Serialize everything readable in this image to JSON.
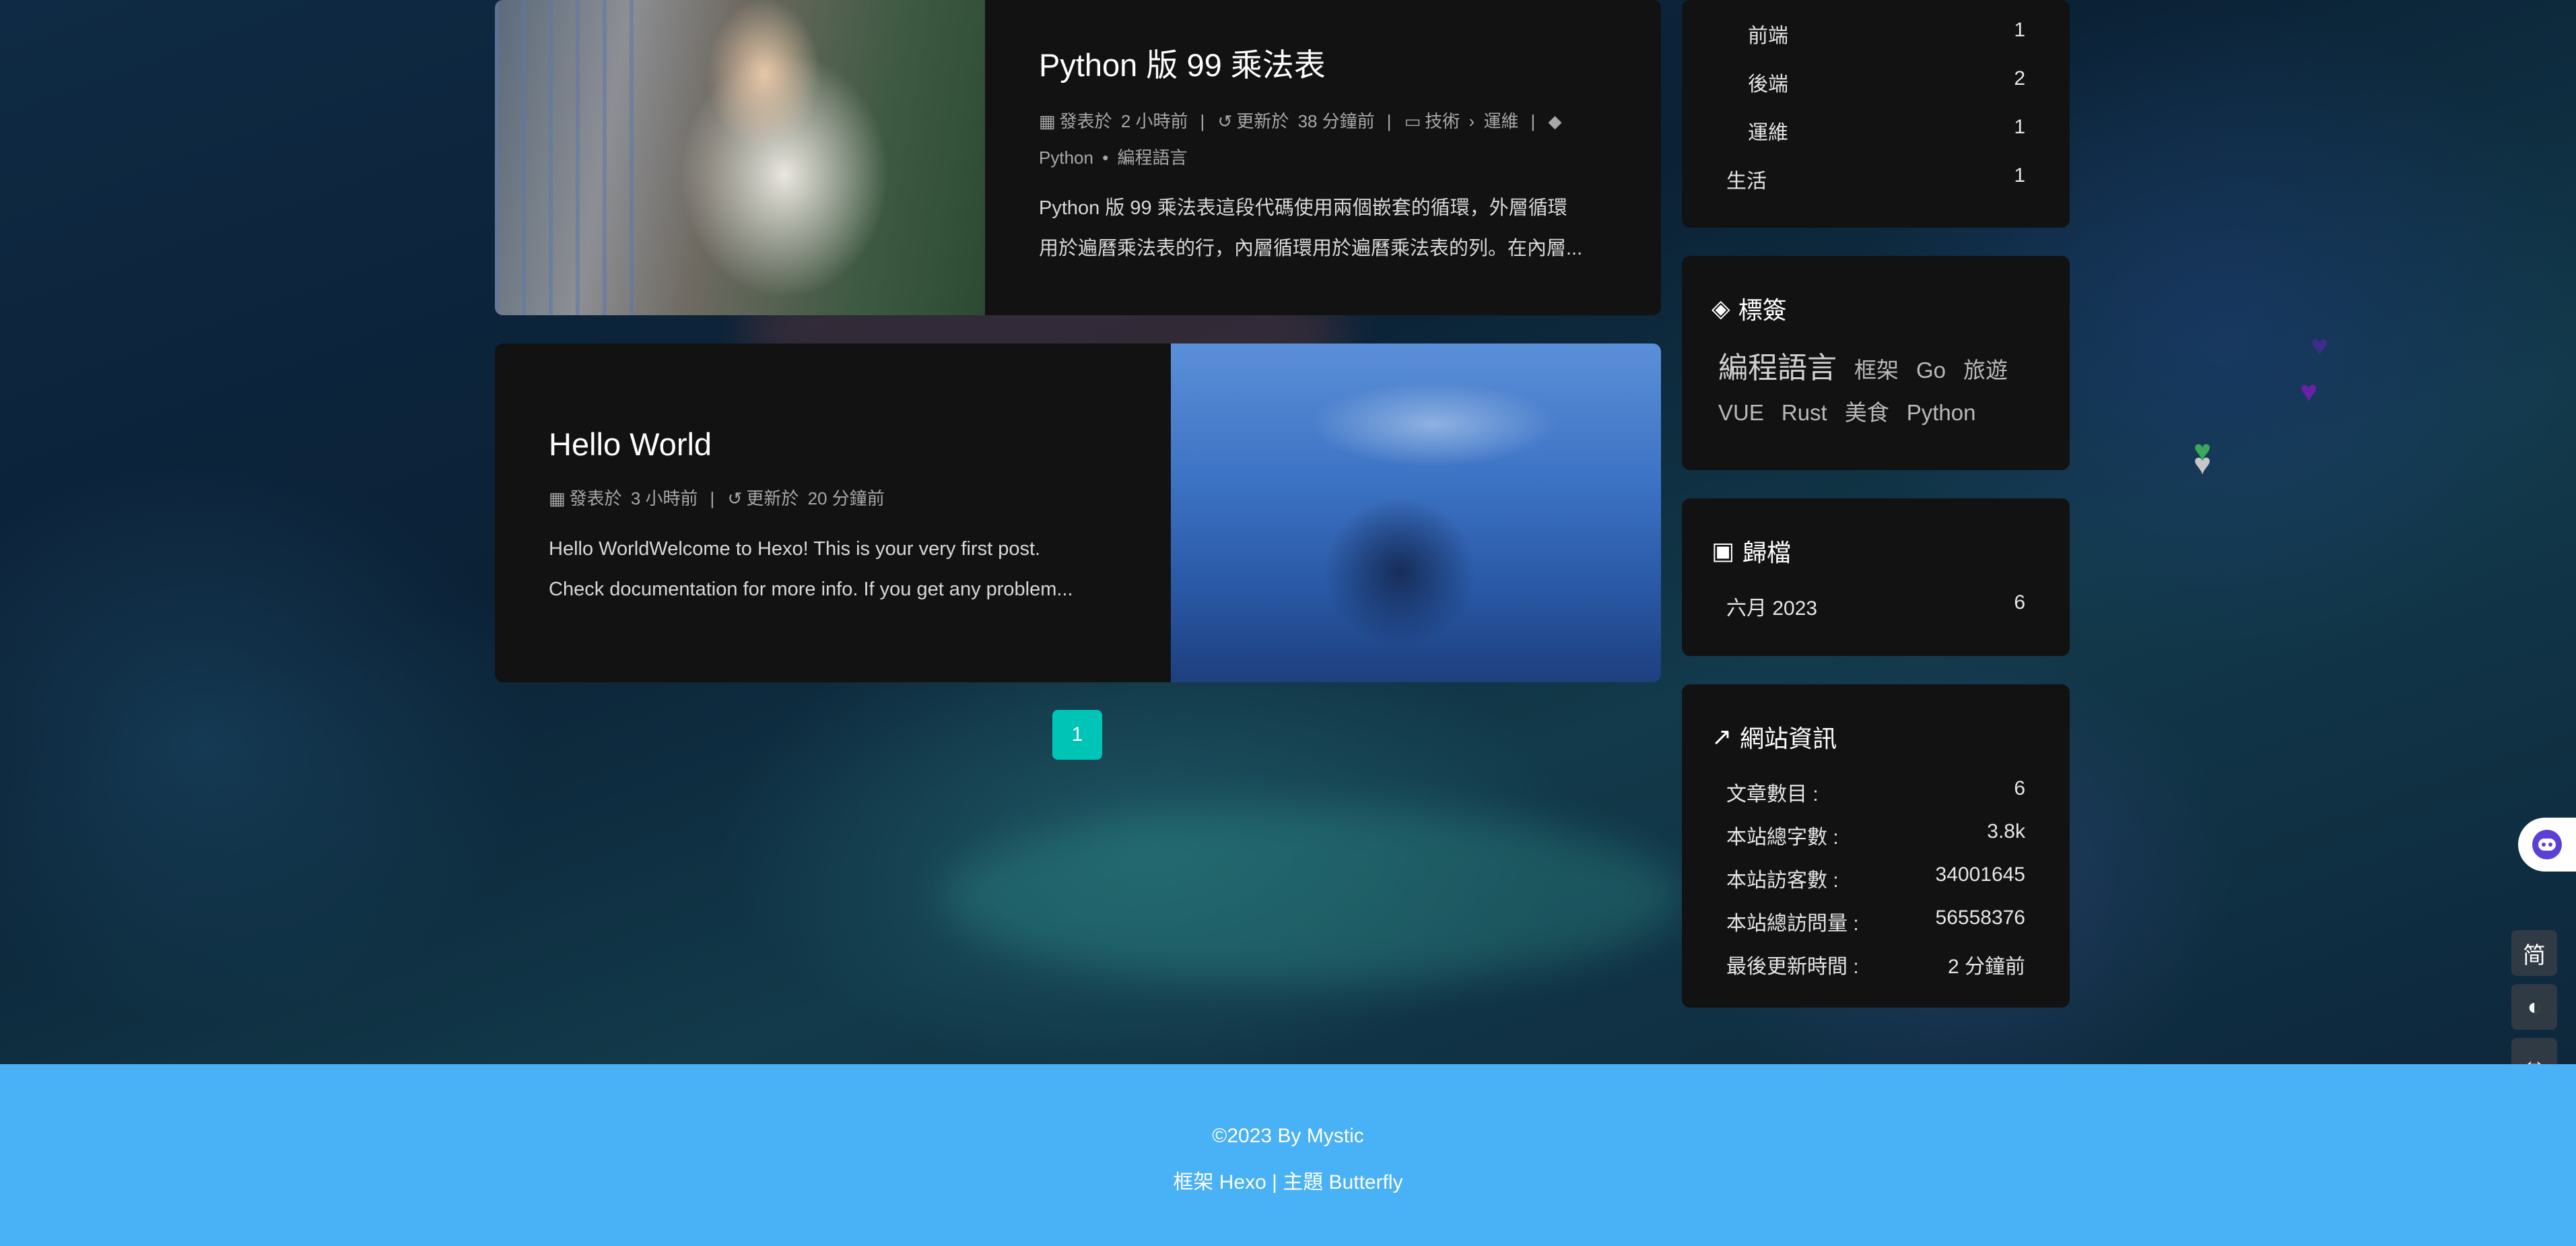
{
  "posts": [
    {
      "title": "Python 版 99 乘法表",
      "published_label": "發表於",
      "published": "2 小時前",
      "updated_label": "更新於",
      "updated": "38 分鐘前",
      "category_parent": "技術",
      "category_child": "運維",
      "tags": [
        "Python",
        "編程語言"
      ],
      "excerpt_l1": "Python 版 99 乘法表這段代碼使用兩個嵌套的循環，外層循環",
      "excerpt_l2": "用於遍曆乘法表的行，內層循環用於遍曆乘法表的列。在內層..."
    },
    {
      "title": "Hello World",
      "published_label": "發表於",
      "published": "3 小時前",
      "updated_label": "更新於",
      "updated": "20 分鐘前",
      "excerpt_l1": "Hello WorldWelcome to Hexo! This is your very first post.",
      "excerpt_l2": "Check documentation for more info. If you get any problem..."
    }
  ],
  "pagination": {
    "current": "1"
  },
  "categories": [
    {
      "name": "前端",
      "count": "1",
      "sub": true
    },
    {
      "name": "後端",
      "count": "2",
      "sub": true
    },
    {
      "name": "運維",
      "count": "1",
      "sub": true
    },
    {
      "name": "生活",
      "count": "1",
      "sub": false
    }
  ],
  "tags_card": {
    "title": "標簽",
    "tags": [
      "編程語言",
      "框架",
      "Go",
      "旅遊",
      "VUE",
      "Rust",
      "美食",
      "Python"
    ]
  },
  "archives": {
    "title": "歸檔",
    "items": [
      {
        "name": "六月 2023",
        "count": "6"
      }
    ]
  },
  "site_info": {
    "title": "網站資訊",
    "rows": [
      {
        "label": "文章數目 :",
        "value": "6"
      },
      {
        "label": "本站總字數 :",
        "value": "3.8k"
      },
      {
        "label": "本站訪客數 :",
        "value": "34001645"
      },
      {
        "label": "本站總訪問量 :",
        "value": "56558376"
      },
      {
        "label": "最後更新時間 :",
        "value": "2 分鐘前"
      }
    ]
  },
  "footer": {
    "copyright": "©2023 By Mystic",
    "framework": "框架 Hexo |  主題 Butterfly"
  },
  "tools": {
    "translate": "简"
  },
  "colors": {
    "accent": "#00c4b6",
    "footer": "#49b1f5",
    "card": "#121212"
  }
}
